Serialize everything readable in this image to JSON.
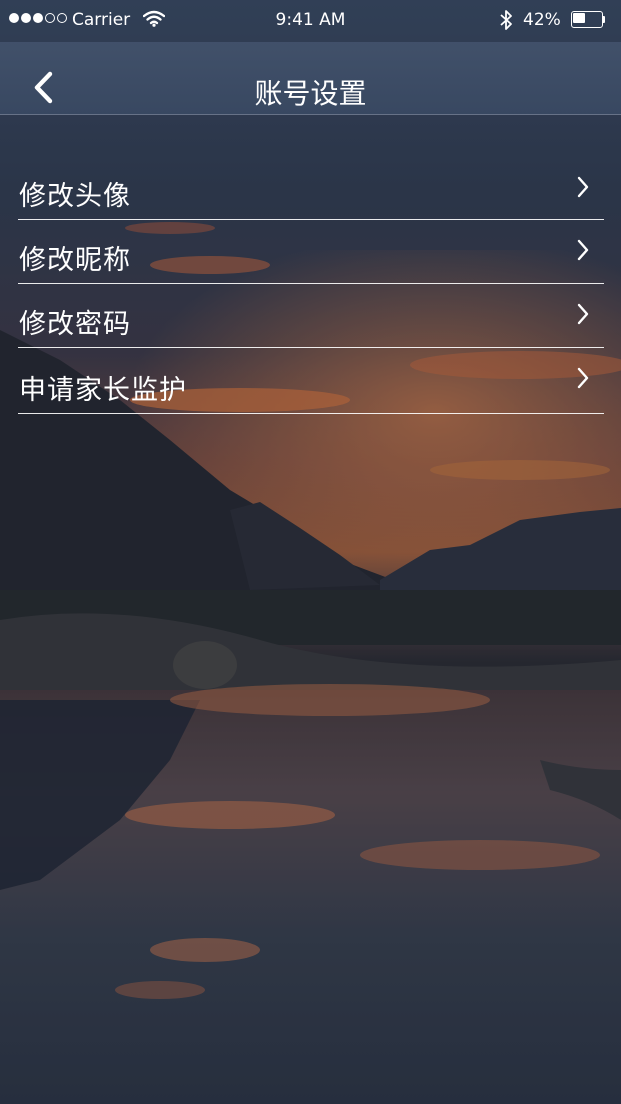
{
  "status_bar": {
    "carrier": "Carrier",
    "time": "9:41 AM",
    "battery_percent": "42%",
    "battery_level": 0.42,
    "signal_bars_filled": 3,
    "signal_bars_total": 5
  },
  "nav": {
    "title": "账号设置",
    "back_icon": "chevron-left-icon"
  },
  "menu": {
    "items": [
      {
        "label": "修改头像",
        "icon": "chevron-right-icon"
      },
      {
        "label": "修改昵称",
        "icon": "chevron-right-icon"
      },
      {
        "label": "修改密码",
        "icon": "chevron-right-icon"
      },
      {
        "label": "申请家长监护",
        "icon": "chevron-right-icon"
      }
    ]
  },
  "colors": {
    "nav_bar": "#44546e",
    "text": "#ffffff",
    "sky_dark": "#2a3448",
    "sunset_orange": "#e0783e"
  }
}
